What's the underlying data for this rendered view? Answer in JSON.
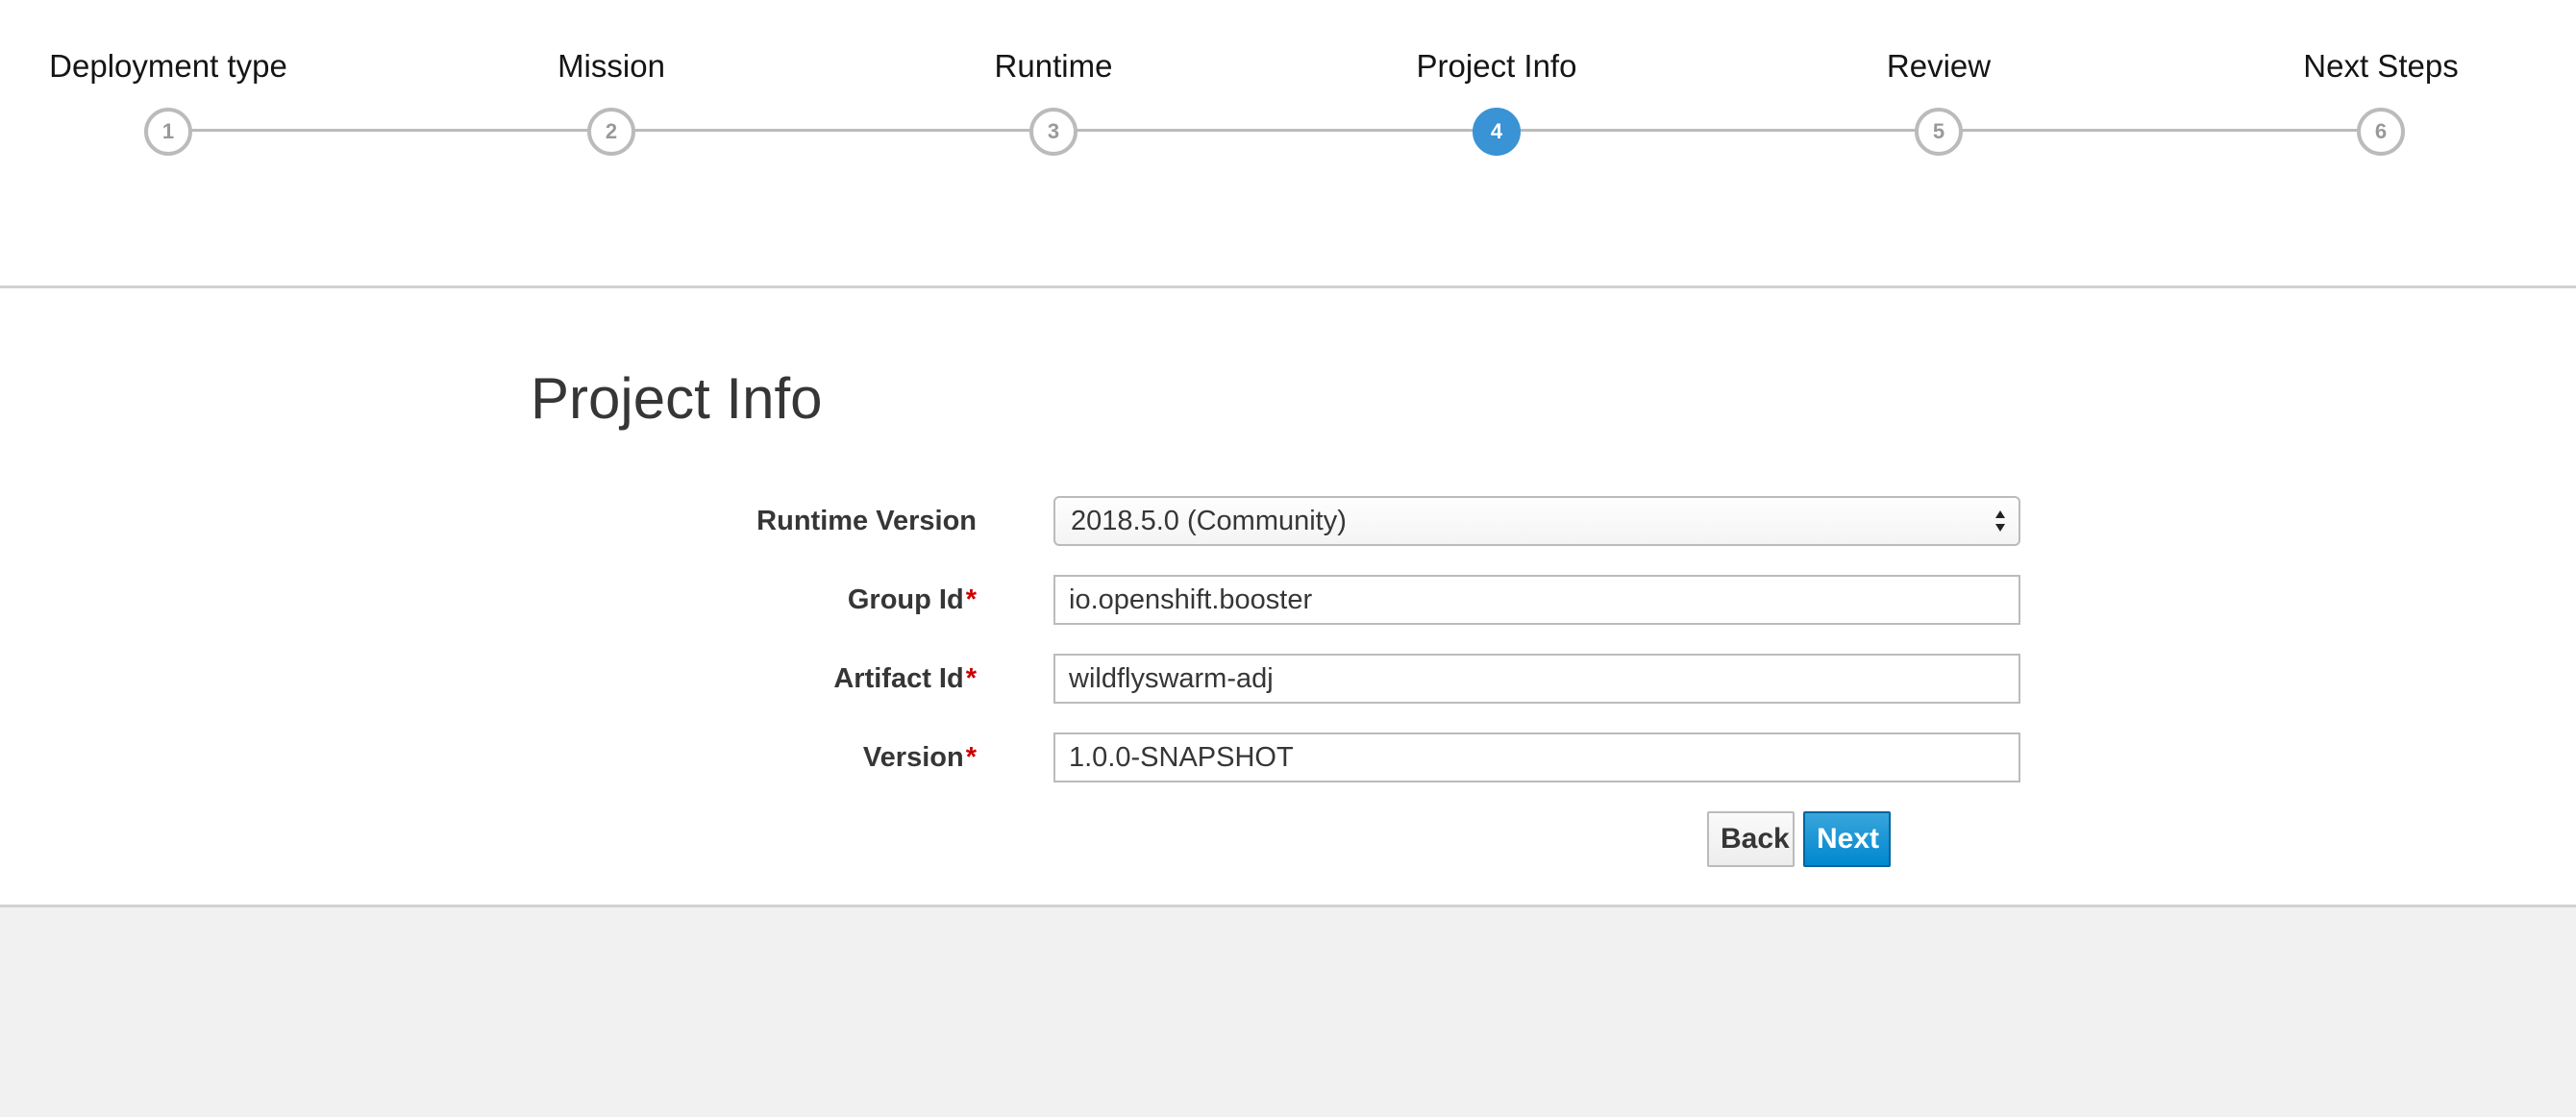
{
  "wizard": {
    "steps": [
      {
        "number": "1",
        "label": "Deployment type"
      },
      {
        "number": "2",
        "label": "Mission"
      },
      {
        "number": "3",
        "label": "Runtime"
      },
      {
        "number": "4",
        "label": "Project Info"
      },
      {
        "number": "5",
        "label": "Review"
      },
      {
        "number": "6",
        "label": "Next Steps"
      }
    ],
    "active_step": 4
  },
  "form": {
    "title": "Project Info",
    "runtime_version": {
      "label": "Runtime Version",
      "value": "2018.5.0 (Community)"
    },
    "group_id": {
      "label": "Group Id",
      "required_mark": "*",
      "value": "io.openshift.booster"
    },
    "artifact_id": {
      "label": "Artifact Id",
      "required_mark": "*",
      "value": "wildflyswarm-adj"
    },
    "version": {
      "label": "Version",
      "required_mark": "*",
      "value": "1.0.0-SNAPSHOT"
    },
    "back_label": "Back",
    "next_label": "Next"
  },
  "colors": {
    "active_step": "#3993d4",
    "primary_button": "#0088ce",
    "required": "#cc0000"
  }
}
